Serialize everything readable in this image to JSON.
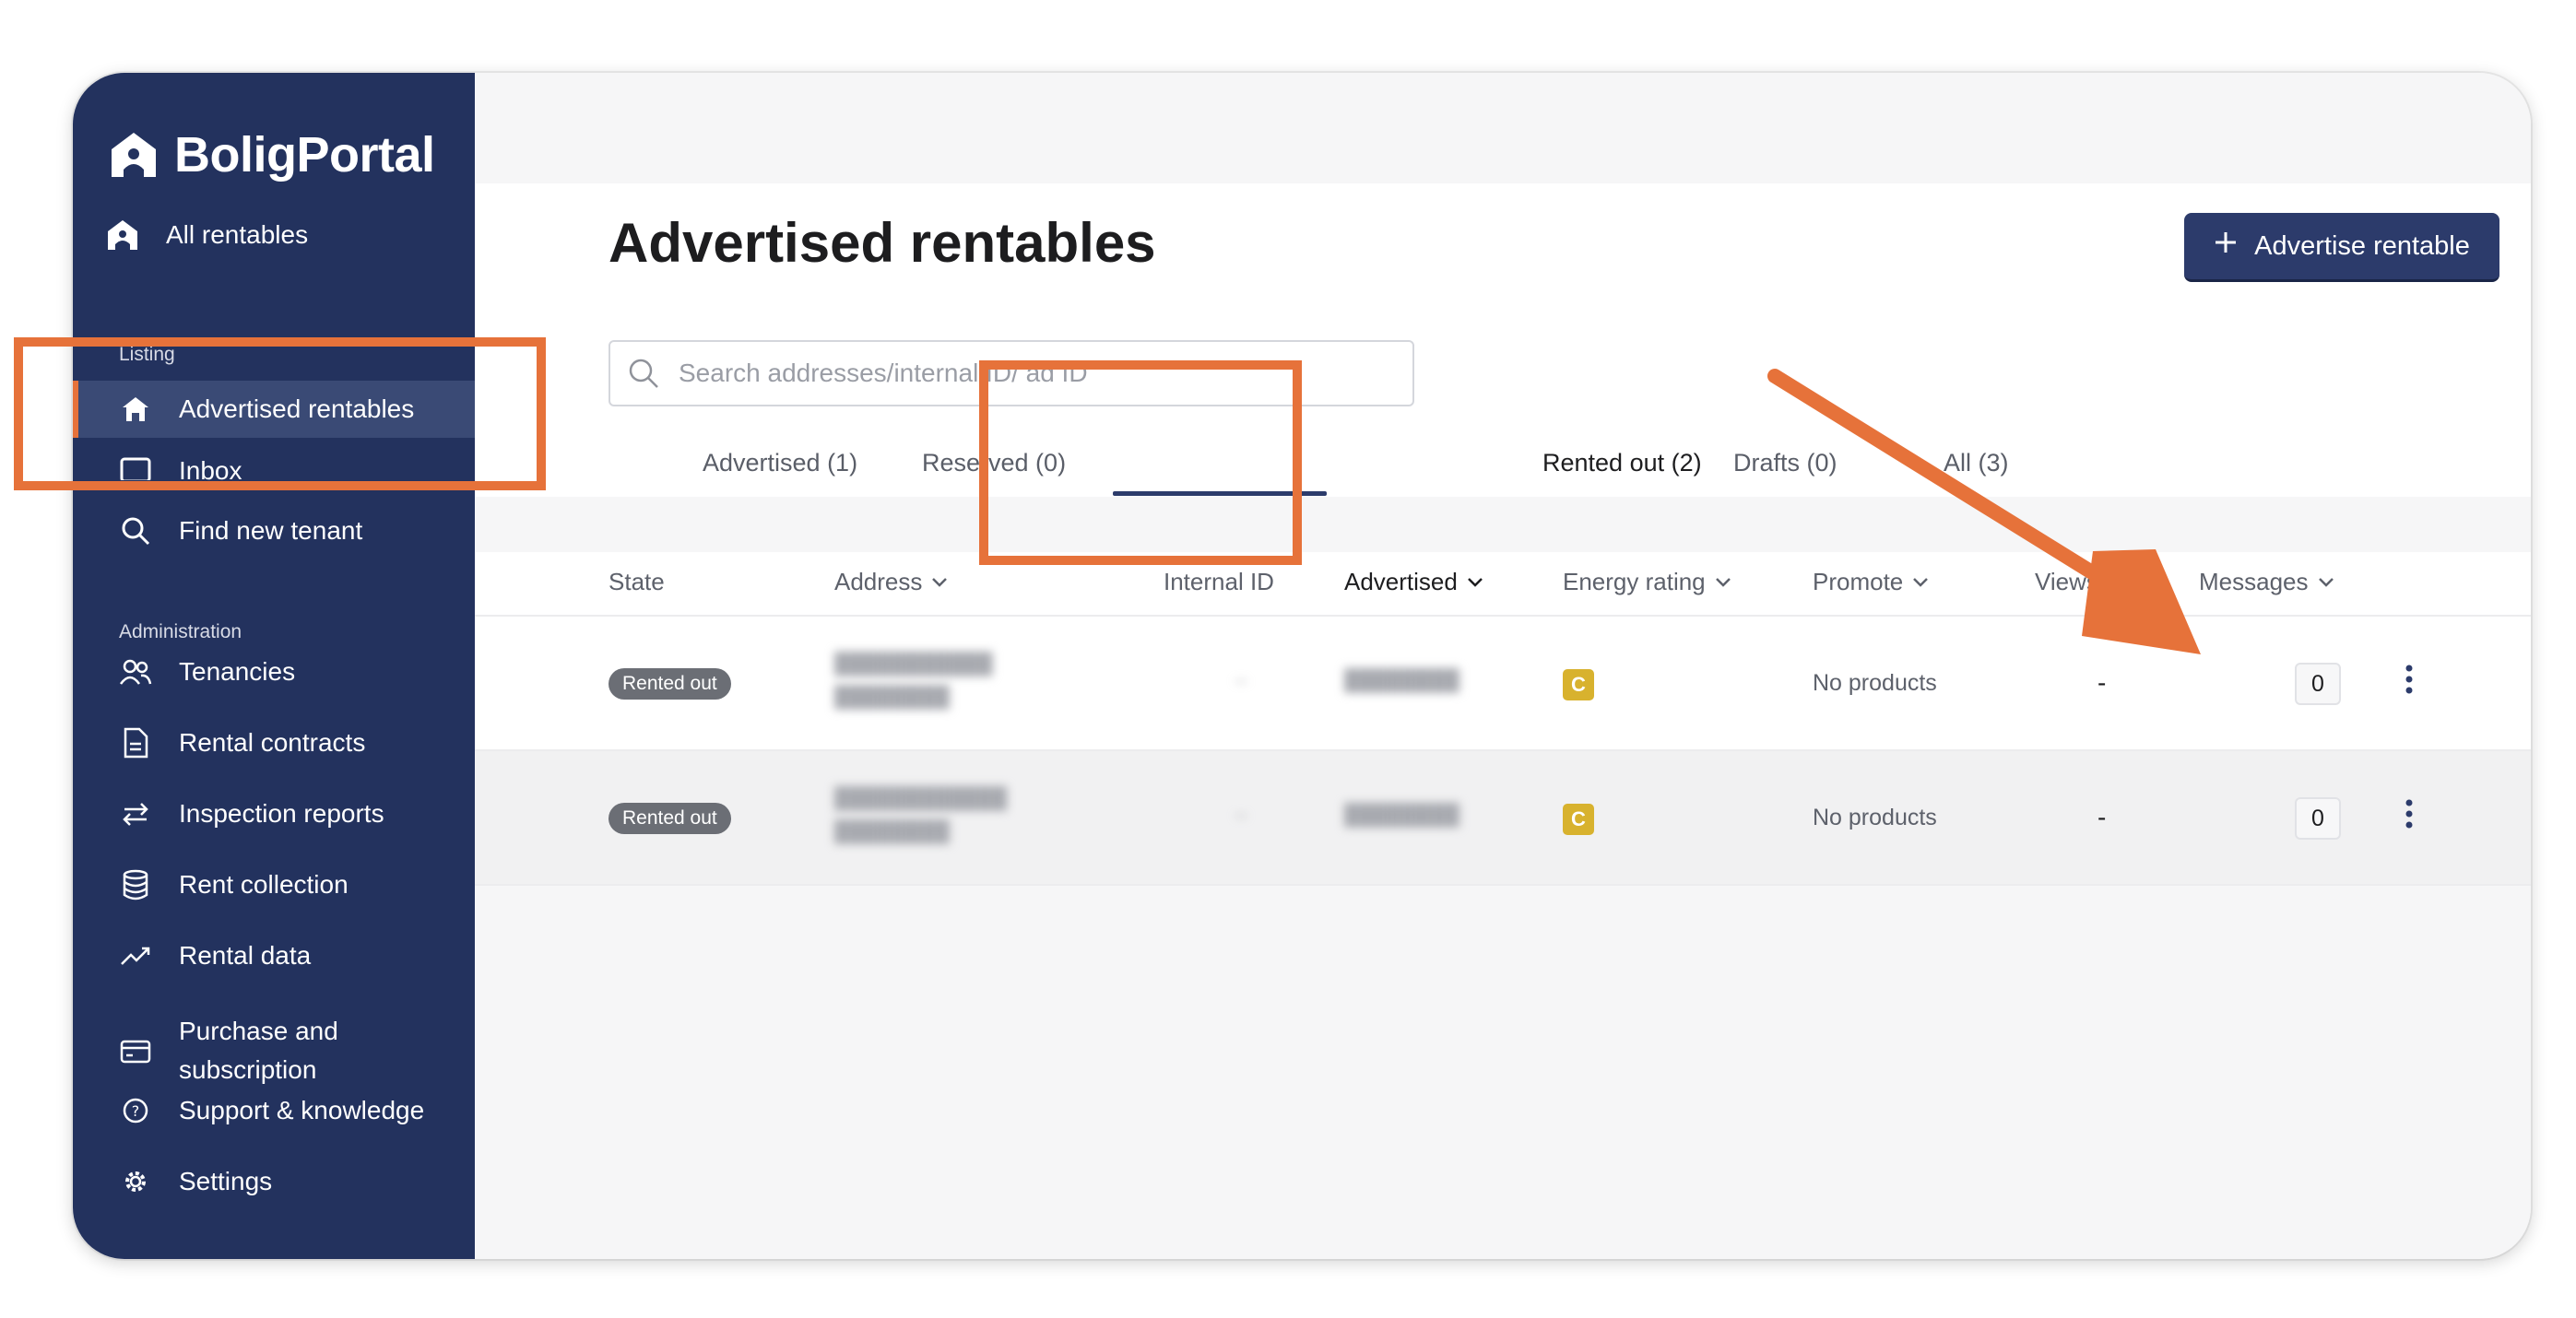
{
  "brand": {
    "name": "BoligPortal"
  },
  "sidebar": {
    "all_rentables": "All rentables",
    "section_listing": "Listing",
    "advertised_rentables": "Advertised rentables",
    "inbox": "Inbox",
    "find_new_tenant": "Find new tenant",
    "section_admin": "Administration",
    "tenancies": "Tenancies",
    "rental_contracts": "Rental contracts",
    "inspection_reports": "Inspection reports",
    "rent_collection": "Rent collection",
    "rental_data": "Rental data",
    "purchase_line1": "Purchase and",
    "purchase_line2": "subscription",
    "support": "Support & knowledge",
    "settings": "Settings"
  },
  "header": {
    "title": "Advertised rentables",
    "advertise_button": "Advertise rentable"
  },
  "search": {
    "placeholder": "Search addresses/internal ID/ ad ID"
  },
  "tabs": [
    {
      "label": "Advertised (1)"
    },
    {
      "label": "Reserved (0)"
    },
    {
      "label": "Rented out (2)"
    },
    {
      "label": "Drafts (0)"
    },
    {
      "label": "All (3)"
    }
  ],
  "table": {
    "columns": {
      "state": "State",
      "address": "Address",
      "internal_id": "Internal ID",
      "advertised": "Advertised",
      "energy_rating": "Energy rating",
      "promote": "Promote",
      "views": "Views",
      "messages": "Messages"
    },
    "rows": [
      {
        "state": "Rented out",
        "energy": "C",
        "promote": "No products",
        "views": "-",
        "messages": "0"
      },
      {
        "state": "Rented out",
        "energy": "C",
        "promote": "No products",
        "views": "-",
        "messages": "0"
      }
    ]
  },
  "colors": {
    "sidebar": "#23325e",
    "accent": "#2c3b6b",
    "annotation": "#e6723a",
    "energy_c": "#d8b22e"
  }
}
